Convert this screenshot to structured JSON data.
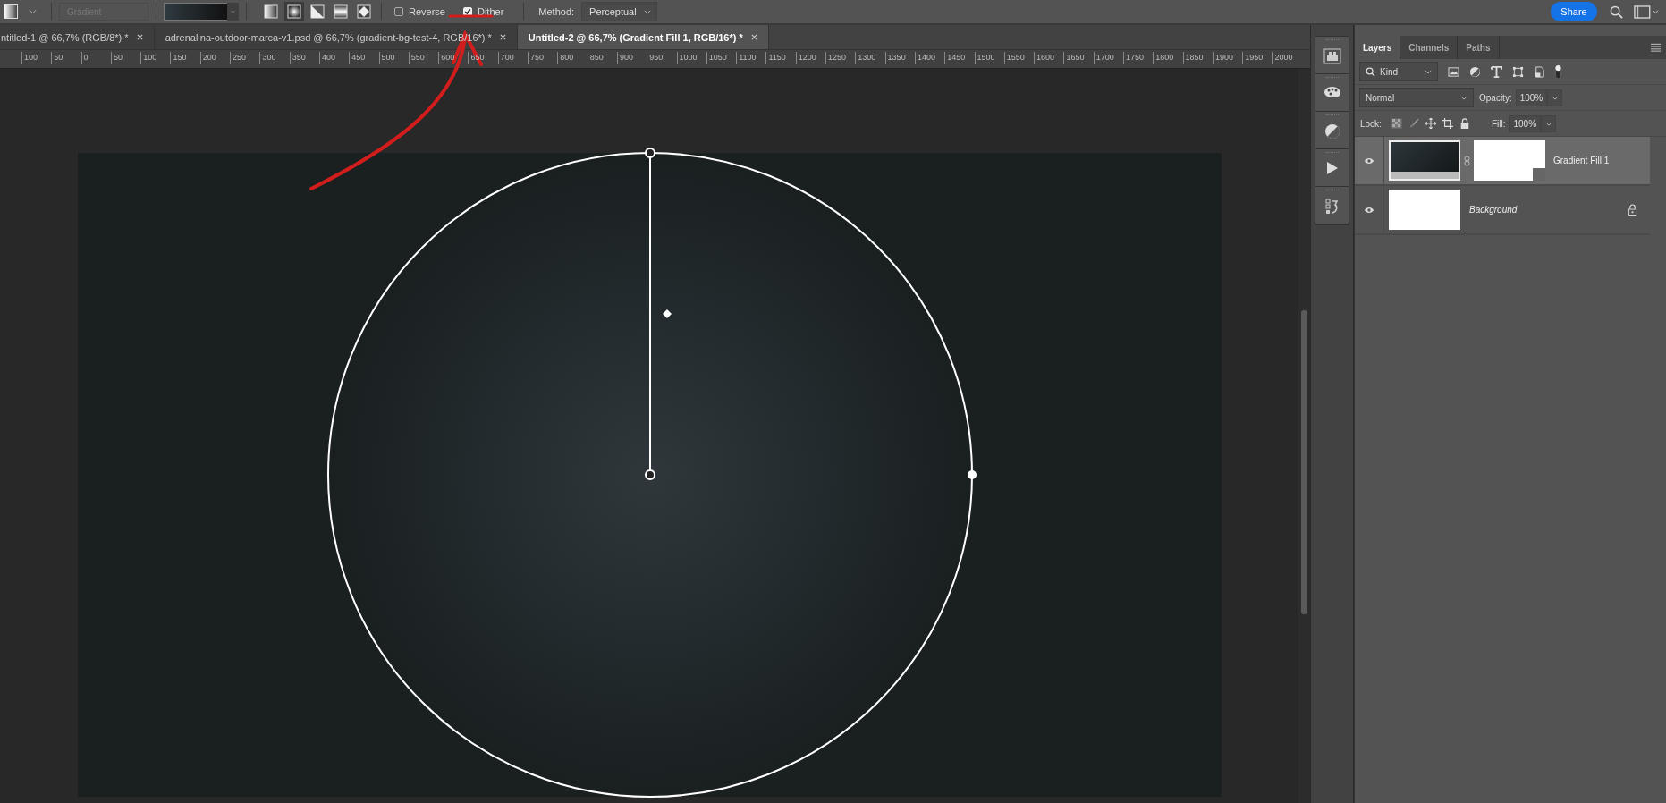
{
  "toolbar": {
    "preset": {
      "value": "Gradient",
      "disabled": true
    },
    "gradient_types": [
      {
        "kind": "linear",
        "selected": false
      },
      {
        "kind": "radial",
        "selected": true
      },
      {
        "kind": "angle",
        "selected": false
      },
      {
        "kind": "reflected",
        "selected": false
      },
      {
        "kind": "diamond",
        "selected": false
      }
    ],
    "options": [
      {
        "label": "Reverse",
        "checked": false
      },
      {
        "label": "Dither",
        "checked": true
      }
    ],
    "method_label": "Method:",
    "method": "Perceptual",
    "share": "Share"
  },
  "tabs": [
    {
      "label": "ntitled-1 @ 66,7% (RGB/8*) *",
      "selected": false
    },
    {
      "label": "adrenalina-outdoor-marca-v1.psd @ 66,7% (gradient-bg-test-4, RGB/16*) *",
      "selected": false
    },
    {
      "label": "Untitled-2 @ 66,7% (Gradient Fill 1, RGB/16*) *",
      "selected": true
    }
  ],
  "ruler": [
    "100",
    "50",
    "0",
    "50",
    "100",
    "150",
    "200",
    "250",
    "300",
    "350",
    "400",
    "450",
    "500",
    "550",
    "600",
    "650",
    "700",
    "750",
    "800",
    "850",
    "900",
    "950",
    "1000",
    "1050",
    "1100",
    "1150",
    "1200",
    "1250",
    "1300",
    "1350",
    "1400",
    "1450",
    "1500",
    "1550",
    "1600",
    "1650",
    "1700",
    "1750",
    "1800",
    "1850",
    "1900",
    "1950",
    "2000"
  ],
  "panel": {
    "tabs": [
      {
        "label": "Layers",
        "selected": true
      },
      {
        "label": "Channels",
        "selected": false
      },
      {
        "label": "Paths",
        "selected": false
      }
    ],
    "filter": "Kind",
    "blend_mode": "Normal",
    "opacity_label": "Opacity:",
    "opacity": "100%",
    "lock_label": "Lock:",
    "fill_label": "Fill:",
    "fill": "100%",
    "layers": [
      {
        "name": "Gradient Fill 1",
        "kind": "gradient",
        "selected": true,
        "visible": true,
        "locked": false
      },
      {
        "name": "Background",
        "kind": "background",
        "selected": false,
        "visible": true,
        "locked": true
      }
    ]
  }
}
